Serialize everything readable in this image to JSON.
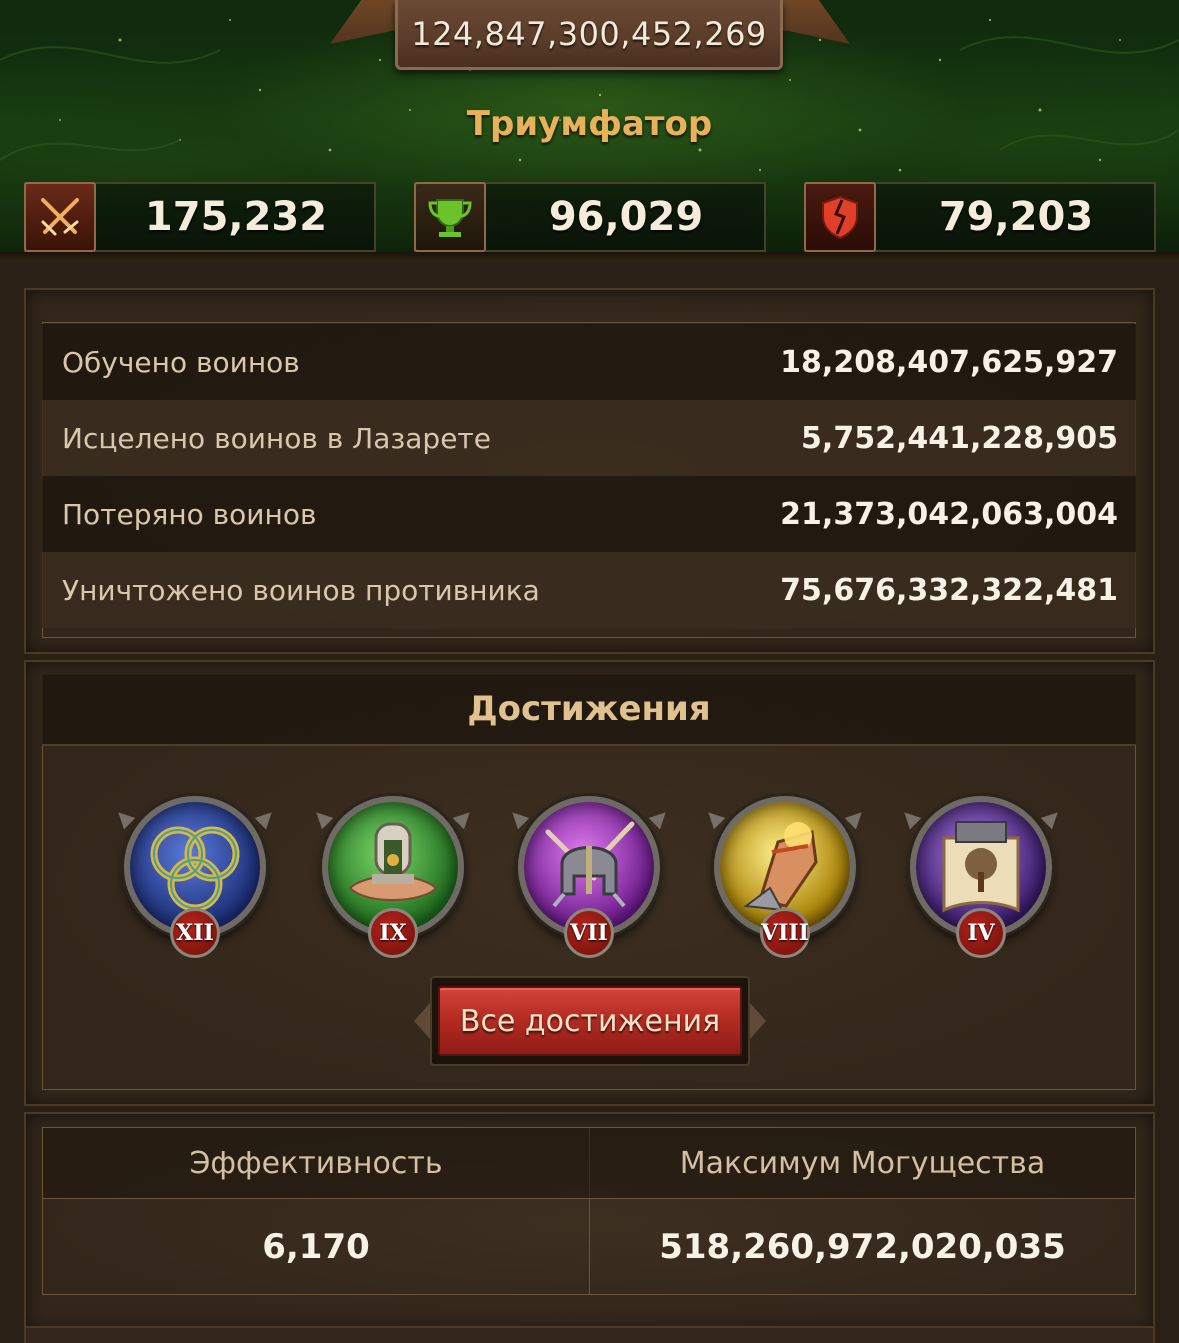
{
  "header": {
    "power_total": "124,847,300,452,269",
    "rank_title": "Триумфатор",
    "stats": [
      {
        "icon": "crossed-swords-icon",
        "value": "175,232"
      },
      {
        "icon": "trophy-icon",
        "value": "96,029"
      },
      {
        "icon": "broken-shield-icon",
        "value": "79,203"
      }
    ]
  },
  "troop_stats": [
    {
      "label": "Обучено воинов",
      "value": "18,208,407,625,927"
    },
    {
      "label": "Исцелено воинов в Лазарете",
      "value": "5,752,441,228,905"
    },
    {
      "label": "Потеряно воинов",
      "value": "21,373,042,063,004"
    },
    {
      "label": "Уничтожено воинов противника",
      "value": "75,676,332,322,481"
    }
  ],
  "achievements": {
    "title": "Достижения",
    "medals": [
      {
        "icon": "golden-rings-medal-icon",
        "rank": "XII",
        "color": "#2b4ea8"
      },
      {
        "icon": "altar-in-hand-medal-icon",
        "rank": "IX",
        "color": "#2f8a2a"
      },
      {
        "icon": "helmet-swords-medal-icon",
        "rank": "VII",
        "color": "#8a2cae"
      },
      {
        "icon": "fist-torch-medal-icon",
        "rank": "VIII",
        "color": "#c7a21e"
      },
      {
        "icon": "tree-scroll-medal-icon",
        "rank": "IV",
        "color": "#6a3aa6"
      }
    ],
    "all_button": "Все достижения"
  },
  "efficiency": {
    "col1_label": "Эффективность",
    "col1_value": "6,170",
    "col2_label": "Максимум Могущества",
    "col2_value": "518,260,972,020,035"
  },
  "colors": {
    "accent_gold": "#e8b25a",
    "button_red": "#b52c23",
    "panel_brown": "#33271b"
  }
}
